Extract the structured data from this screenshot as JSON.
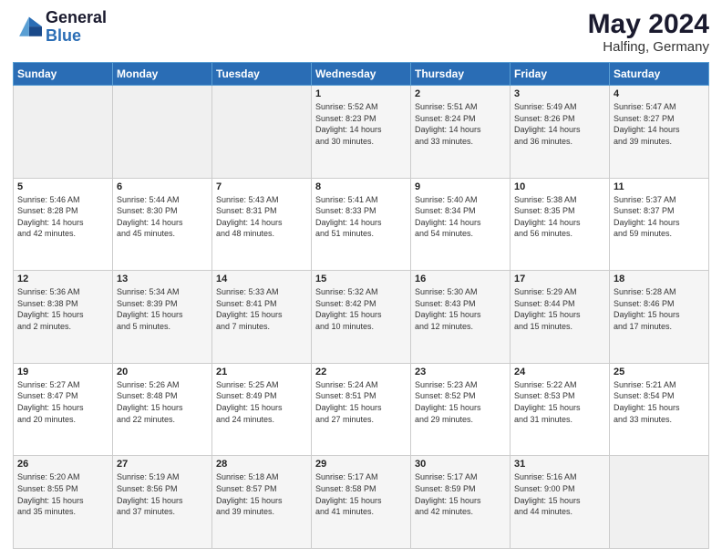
{
  "header": {
    "logo_line1": "General",
    "logo_line2": "Blue",
    "main_title": "May 2024",
    "sub_title": "Halfing, Germany"
  },
  "days_of_week": [
    "Sunday",
    "Monday",
    "Tuesday",
    "Wednesday",
    "Thursday",
    "Friday",
    "Saturday"
  ],
  "weeks": [
    [
      {
        "num": "",
        "info": ""
      },
      {
        "num": "",
        "info": ""
      },
      {
        "num": "",
        "info": ""
      },
      {
        "num": "1",
        "info": "Sunrise: 5:52 AM\nSunset: 8:23 PM\nDaylight: 14 hours\nand 30 minutes."
      },
      {
        "num": "2",
        "info": "Sunrise: 5:51 AM\nSunset: 8:24 PM\nDaylight: 14 hours\nand 33 minutes."
      },
      {
        "num": "3",
        "info": "Sunrise: 5:49 AM\nSunset: 8:26 PM\nDaylight: 14 hours\nand 36 minutes."
      },
      {
        "num": "4",
        "info": "Sunrise: 5:47 AM\nSunset: 8:27 PM\nDaylight: 14 hours\nand 39 minutes."
      }
    ],
    [
      {
        "num": "5",
        "info": "Sunrise: 5:46 AM\nSunset: 8:28 PM\nDaylight: 14 hours\nand 42 minutes."
      },
      {
        "num": "6",
        "info": "Sunrise: 5:44 AM\nSunset: 8:30 PM\nDaylight: 14 hours\nand 45 minutes."
      },
      {
        "num": "7",
        "info": "Sunrise: 5:43 AM\nSunset: 8:31 PM\nDaylight: 14 hours\nand 48 minutes."
      },
      {
        "num": "8",
        "info": "Sunrise: 5:41 AM\nSunset: 8:33 PM\nDaylight: 14 hours\nand 51 minutes."
      },
      {
        "num": "9",
        "info": "Sunrise: 5:40 AM\nSunset: 8:34 PM\nDaylight: 14 hours\nand 54 minutes."
      },
      {
        "num": "10",
        "info": "Sunrise: 5:38 AM\nSunset: 8:35 PM\nDaylight: 14 hours\nand 56 minutes."
      },
      {
        "num": "11",
        "info": "Sunrise: 5:37 AM\nSunset: 8:37 PM\nDaylight: 14 hours\nand 59 minutes."
      }
    ],
    [
      {
        "num": "12",
        "info": "Sunrise: 5:36 AM\nSunset: 8:38 PM\nDaylight: 15 hours\nand 2 minutes."
      },
      {
        "num": "13",
        "info": "Sunrise: 5:34 AM\nSunset: 8:39 PM\nDaylight: 15 hours\nand 5 minutes."
      },
      {
        "num": "14",
        "info": "Sunrise: 5:33 AM\nSunset: 8:41 PM\nDaylight: 15 hours\nand 7 minutes."
      },
      {
        "num": "15",
        "info": "Sunrise: 5:32 AM\nSunset: 8:42 PM\nDaylight: 15 hours\nand 10 minutes."
      },
      {
        "num": "16",
        "info": "Sunrise: 5:30 AM\nSunset: 8:43 PM\nDaylight: 15 hours\nand 12 minutes."
      },
      {
        "num": "17",
        "info": "Sunrise: 5:29 AM\nSunset: 8:44 PM\nDaylight: 15 hours\nand 15 minutes."
      },
      {
        "num": "18",
        "info": "Sunrise: 5:28 AM\nSunset: 8:46 PM\nDaylight: 15 hours\nand 17 minutes."
      }
    ],
    [
      {
        "num": "19",
        "info": "Sunrise: 5:27 AM\nSunset: 8:47 PM\nDaylight: 15 hours\nand 20 minutes."
      },
      {
        "num": "20",
        "info": "Sunrise: 5:26 AM\nSunset: 8:48 PM\nDaylight: 15 hours\nand 22 minutes."
      },
      {
        "num": "21",
        "info": "Sunrise: 5:25 AM\nSunset: 8:49 PM\nDaylight: 15 hours\nand 24 minutes."
      },
      {
        "num": "22",
        "info": "Sunrise: 5:24 AM\nSunset: 8:51 PM\nDaylight: 15 hours\nand 27 minutes."
      },
      {
        "num": "23",
        "info": "Sunrise: 5:23 AM\nSunset: 8:52 PM\nDaylight: 15 hours\nand 29 minutes."
      },
      {
        "num": "24",
        "info": "Sunrise: 5:22 AM\nSunset: 8:53 PM\nDaylight: 15 hours\nand 31 minutes."
      },
      {
        "num": "25",
        "info": "Sunrise: 5:21 AM\nSunset: 8:54 PM\nDaylight: 15 hours\nand 33 minutes."
      }
    ],
    [
      {
        "num": "26",
        "info": "Sunrise: 5:20 AM\nSunset: 8:55 PM\nDaylight: 15 hours\nand 35 minutes."
      },
      {
        "num": "27",
        "info": "Sunrise: 5:19 AM\nSunset: 8:56 PM\nDaylight: 15 hours\nand 37 minutes."
      },
      {
        "num": "28",
        "info": "Sunrise: 5:18 AM\nSunset: 8:57 PM\nDaylight: 15 hours\nand 39 minutes."
      },
      {
        "num": "29",
        "info": "Sunrise: 5:17 AM\nSunset: 8:58 PM\nDaylight: 15 hours\nand 41 minutes."
      },
      {
        "num": "30",
        "info": "Sunrise: 5:17 AM\nSunset: 8:59 PM\nDaylight: 15 hours\nand 42 minutes."
      },
      {
        "num": "31",
        "info": "Sunrise: 5:16 AM\nSunset: 9:00 PM\nDaylight: 15 hours\nand 44 minutes."
      },
      {
        "num": "",
        "info": ""
      }
    ]
  ]
}
